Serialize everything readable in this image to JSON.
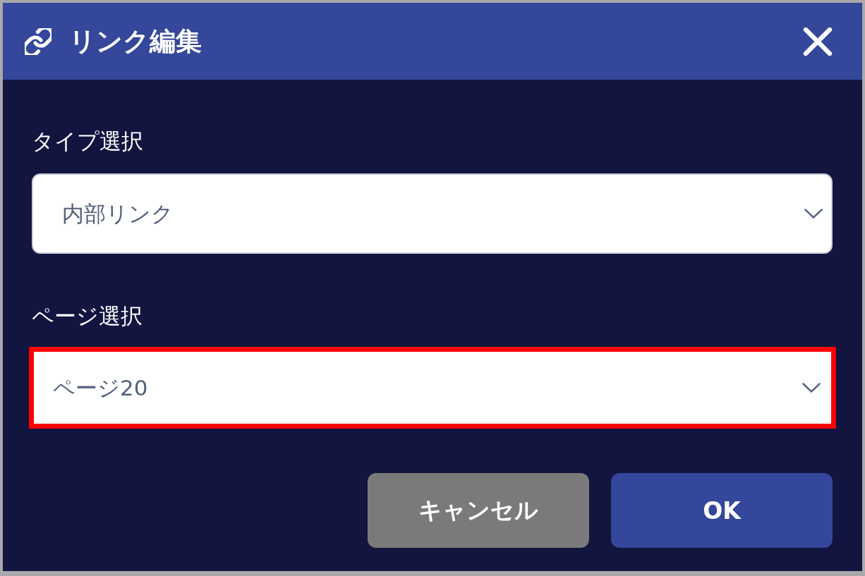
{
  "dialog": {
    "title": "リンク編集"
  },
  "fields": [
    {
      "label": "タイプ選択",
      "value": "内部リンク",
      "highlighted": false
    },
    {
      "label": "ページ選択",
      "value": "ページ20",
      "highlighted": true
    }
  ],
  "buttons": [
    {
      "label": "キャンセル",
      "kind": "secondary"
    },
    {
      "label": "OK",
      "kind": "primary"
    }
  ]
}
